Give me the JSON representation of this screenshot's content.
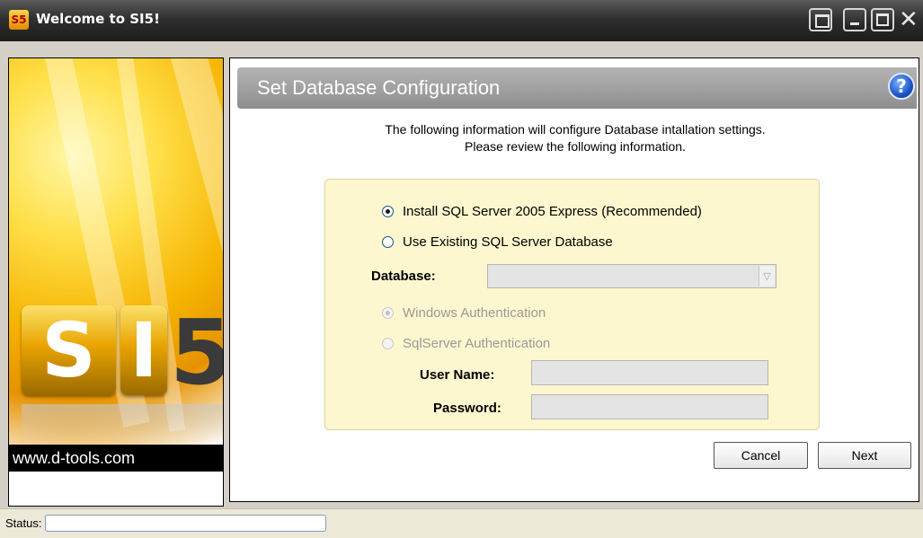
{
  "window": {
    "title": "Welcome to SI5!",
    "app_icon_text": "S5"
  },
  "titlebar_buttons": {
    "close_glyph": "✕"
  },
  "left_panel": {
    "logo_text": "SI5",
    "website": "www.d-tools.com"
  },
  "header": {
    "title": "Set Database Configuration",
    "help_glyph": "?"
  },
  "intro": {
    "line1": "The following information will configure Database intallation settings.",
    "line2": "Please review the following information."
  },
  "options": {
    "install_express": "Install SQL Server 2005 Express (Recommended)",
    "use_existing": "Use Existing SQL Server Database",
    "database_label": "Database:",
    "database_value": "",
    "windows_auth": "Windows Authentication",
    "sqlserver_auth": "SqlServer Authentication",
    "username_label": "User Name:",
    "password_label": "Password:"
  },
  "buttons": {
    "cancel": "Cancel",
    "next": "Next"
  },
  "status": {
    "label": "Status:",
    "value": ""
  },
  "icons": [
    "window-app-icon",
    "restore-icon",
    "minimize-icon",
    "maximize-icon",
    "close-icon",
    "help-icon",
    "combo-arrow-icon"
  ]
}
